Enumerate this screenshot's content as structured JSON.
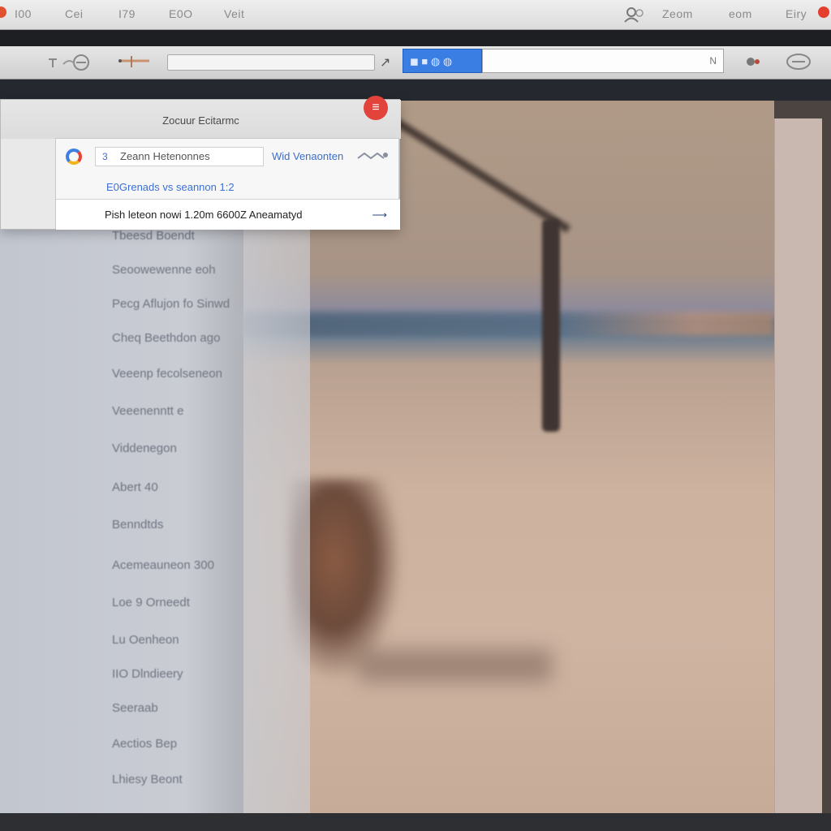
{
  "menubar": {
    "items": [
      "I00",
      "Cei",
      "I79",
      "E0O",
      "Veit"
    ],
    "right_items": [
      "Zeom",
      "eom",
      "Eiry"
    ]
  },
  "toolbar": {
    "tab_label": "◼ ■ ◍ ◍",
    "url_suffix": "N"
  },
  "dialog": {
    "title": "Zocuur Ecitarmc",
    "close_glyph": "≡",
    "search_number": "3",
    "search_text": "Zeann Hetenonnes",
    "link_text": "Wid Venaonten",
    "suggestion_blue": "E0Grenads vs seannon 1:2",
    "suggestion_main": "Pish leteon nowi 1.20m 6600Z Aneamatyd"
  },
  "sidebar": {
    "items": [
      "Tbeesd Boendt",
      "Seoowewenne eoh",
      "Pecg Aflujon fo Sinwd",
      "Cheq Beethdon ago",
      "Veeenp fecolseneon",
      "Veeenenntt e",
      "Viddenegon",
      "Abert 40",
      "Benndtds",
      "Acemeauneon 300",
      "Loe 9 Orneedt",
      "Lu Oenheon",
      "IIO Dlndieery",
      "Seeraab",
      "Aectios Bep",
      "Lhiesy Beont"
    ]
  },
  "colors": {
    "accent_blue": "#3a7ee4",
    "close_red": "#e2433b",
    "link_blue": "#3e6dc7"
  }
}
